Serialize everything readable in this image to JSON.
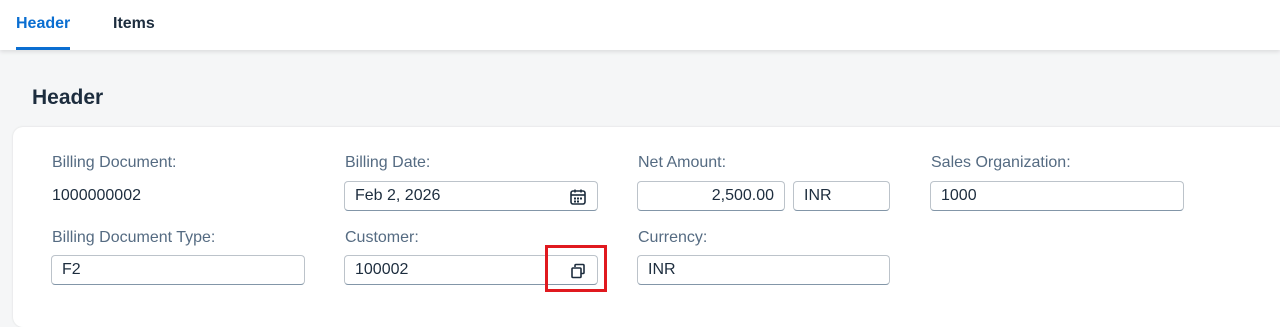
{
  "tabs": {
    "header": "Header",
    "items": "Items"
  },
  "section": {
    "title": "Header"
  },
  "fields": {
    "billing_document": {
      "label": "Billing Document:",
      "value": "1000000002"
    },
    "billing_date": {
      "label": "Billing Date:",
      "value": "Feb 2, 2026",
      "icon": "calendar-icon"
    },
    "net_amount": {
      "label": "Net Amount:",
      "value": "2,500.00",
      "currency": "INR"
    },
    "sales_organization": {
      "label": "Sales Organization:",
      "value": "1000"
    },
    "billing_document_type": {
      "label": "Billing Document Type:",
      "value": "F2"
    },
    "customer": {
      "label": "Customer:",
      "value": "100002",
      "icon": "value-help-icon"
    },
    "currency": {
      "label": "Currency:",
      "value": "INR"
    }
  },
  "colors": {
    "accent": "#0a6ed1",
    "highlight": "#e0191f"
  }
}
